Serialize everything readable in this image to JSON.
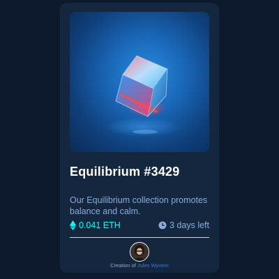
{
  "card": {
    "image_alt": "Equilibrium glass cube",
    "title": "Equilibrium #3429",
    "description": "Our Equilibrium collection promotes balance and calm.",
    "price": "0.041 ETH",
    "time_left": "3 days left",
    "creator_prefix": "Creation of",
    "creator_name": "Jules Wyvern"
  },
  "icons": {
    "price": "ethereum-icon",
    "time": "clock-icon"
  },
  "colors": {
    "page_bg": "#0d192c",
    "card_bg": "#15263f",
    "title": "#ffffff",
    "text_soft": "#8bacd9",
    "price_cyan": "#00fff8",
    "link_blue": "#3a7bd5"
  }
}
